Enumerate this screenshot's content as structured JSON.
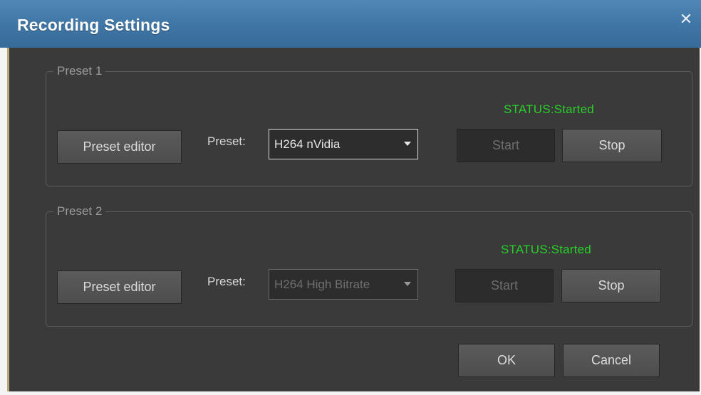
{
  "window": {
    "title": "Recording Settings",
    "close_glyph": "✕"
  },
  "presets": [
    {
      "legend": "Preset 1",
      "status": "STATUS:Started",
      "preset_editor_label": "Preset editor",
      "preset_label": "Preset:",
      "selected": "H264 nVidia",
      "select_enabled": true,
      "start_label": "Start",
      "start_enabled": false,
      "stop_label": "Stop"
    },
    {
      "legend": "Preset 2",
      "status": "STATUS:Started",
      "preset_editor_label": "Preset editor",
      "preset_label": "Preset:",
      "selected": "H264 High Bitrate",
      "select_enabled": false,
      "start_label": "Start",
      "start_enabled": false,
      "stop_label": "Stop"
    }
  ],
  "footer": {
    "ok_label": "OK",
    "cancel_label": "Cancel"
  },
  "colors": {
    "titlebar": "#3f75a5",
    "body": "#3a3a3a",
    "status": "#28d028"
  },
  "icons": {
    "close": "close-icon",
    "dropdown": "chevron-down-icon"
  }
}
